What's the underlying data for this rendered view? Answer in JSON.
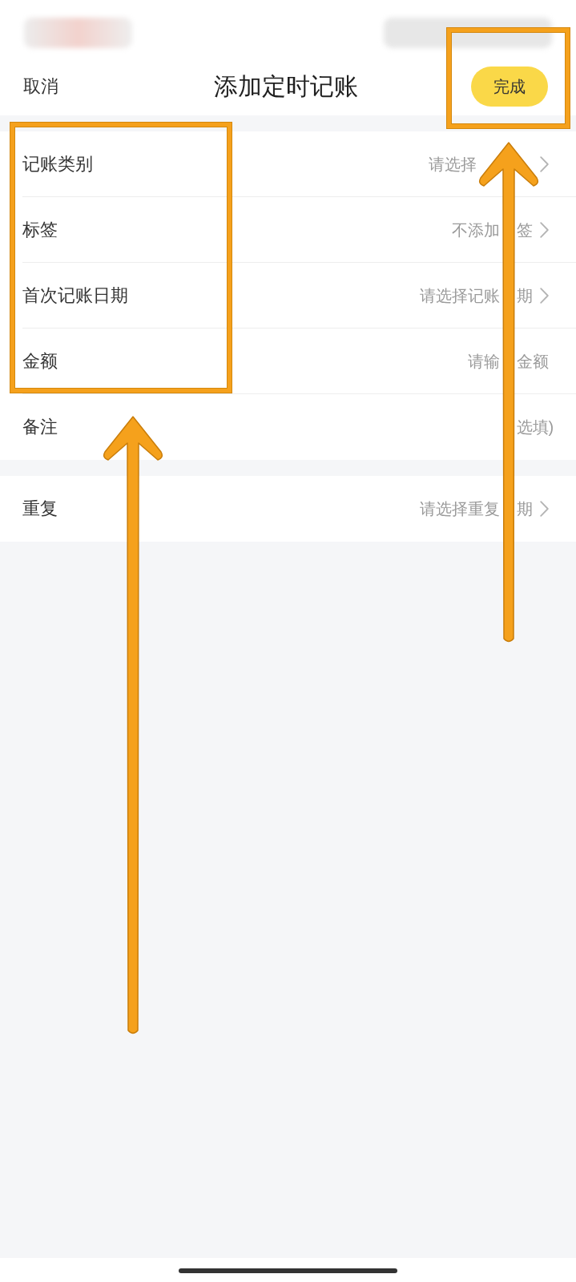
{
  "nav_bar": {
    "cancel": "取消",
    "title": "添加定时记账",
    "done": {
      "label": "完成",
      "highlighted": true
    }
  },
  "sections": [
    {
      "rows": [
        {
          "kind": "picker",
          "label": "记账类别",
          "placeholder": {
            "start": "请选择"
          },
          "highlighted": true
        },
        {
          "kind": "picker",
          "label": "标签",
          "placeholder": {
            "start": "不添加",
            "end": "签"
          },
          "highlighted": true
        },
        {
          "kind": "picker",
          "label": "首次记账日期",
          "placeholder": {
            "start": "请选择记账",
            "end": "期"
          },
          "highlighted": true
        },
        {
          "kind": "input",
          "label": "金额",
          "placeholder": {
            "start": "请输",
            "end": "金额"
          },
          "highlighted": true
        },
        {
          "kind": "input",
          "label": "备注",
          "placeholder": {
            "end": "选填)"
          },
          "highlighted": false
        }
      ]
    },
    {
      "rows": [
        {
          "kind": "picker",
          "label": "重复",
          "placeholder": {
            "start": "请选择重复",
            "end": "期"
          },
          "highlighted": false
        }
      ]
    }
  ]
}
